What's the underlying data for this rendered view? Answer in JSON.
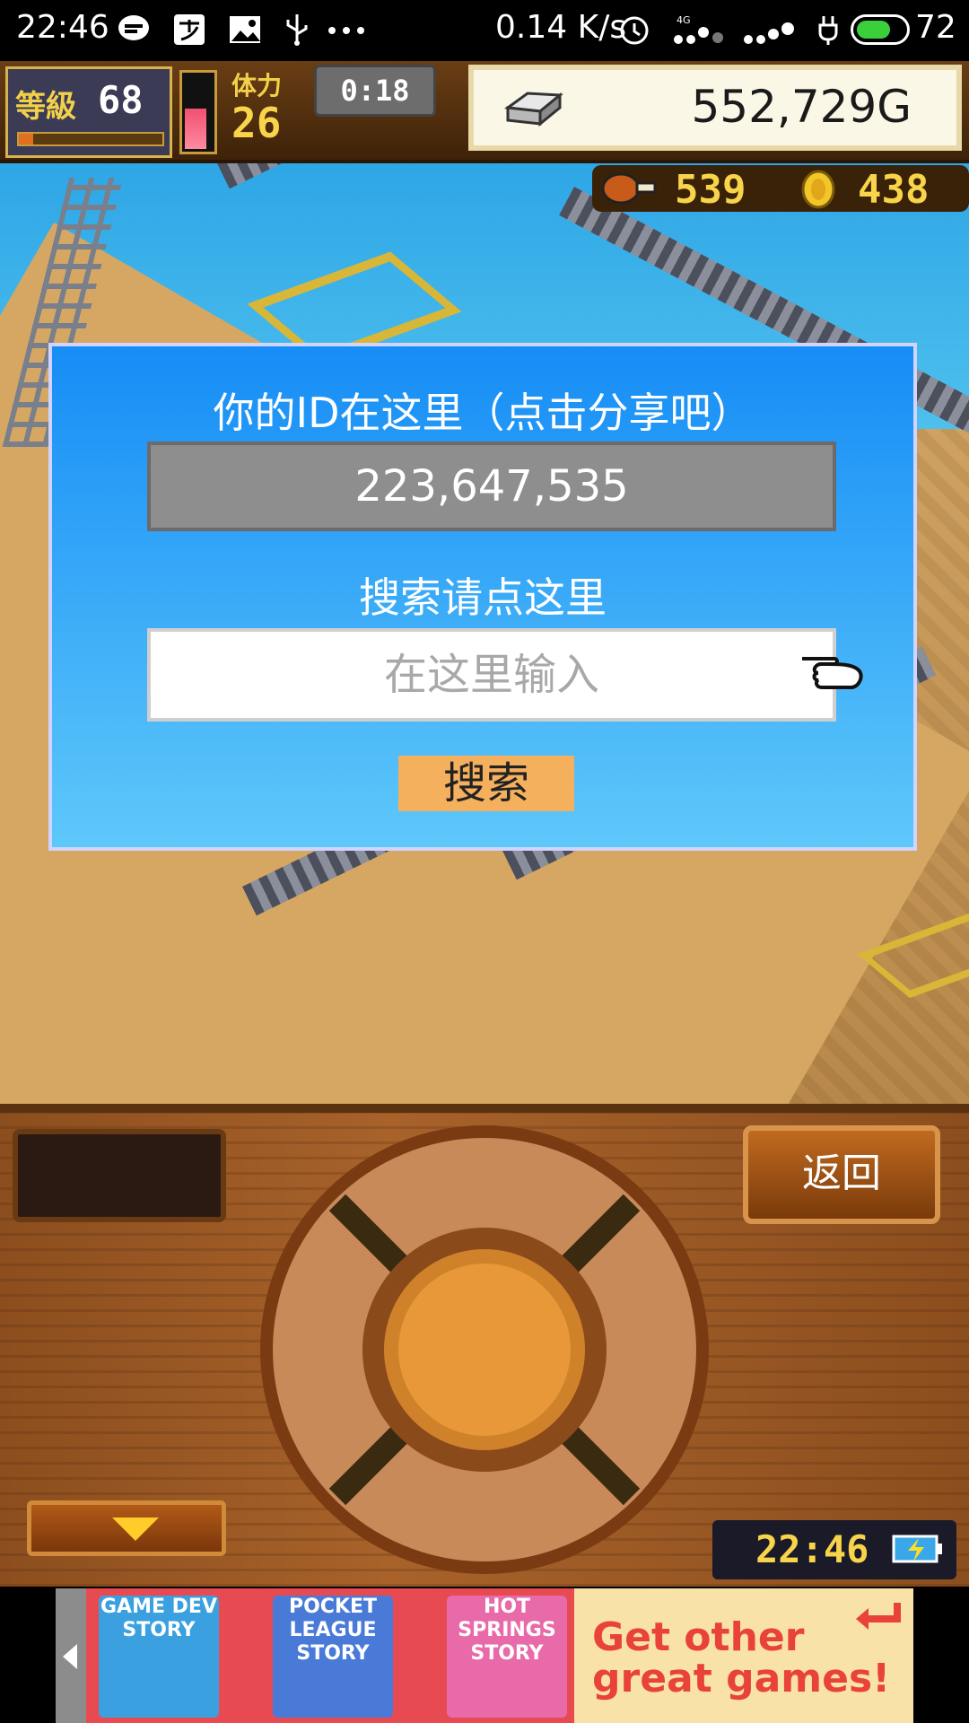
{
  "status_bar": {
    "time": "22:46",
    "net_speed": "0.14 K/s",
    "battery_percent": "72",
    "battery_level": 0.72,
    "icons": [
      "chat-bubble-icon",
      "alipay-icon",
      "image-icon",
      "usb-icon",
      "more-dots-icon",
      "alarm-icon",
      "signal-4g-icon",
      "signal-icon",
      "charging-icon",
      "battery-icon"
    ]
  },
  "hud": {
    "level_label": "等級",
    "level_value": "68",
    "level_progress": 0.1,
    "stamina_label": "体力",
    "stamina_value": "26",
    "stamina_fill": 0.55,
    "timer": "0:18",
    "money": "552,729G",
    "food": "539",
    "coins": "438"
  },
  "dialog": {
    "title": "你的ID在这里（点击分享吧）",
    "user_id": "223,647,535",
    "search_label": "搜索请点这里",
    "search_placeholder": "在这里输入",
    "search_button": "搜索"
  },
  "panel": {
    "back_button": "返回",
    "clock": "22:46"
  },
  "ad": {
    "games": [
      {
        "lines": [
          "GAME DEV",
          "STORY"
        ],
        "color": "#3aa0e0"
      },
      {
        "lines": [
          "POCKET",
          "LEAGUE",
          "STORY"
        ],
        "color": "#4a7ad8"
      },
      {
        "lines": [
          "HOT",
          "SPRINGS",
          "STORY"
        ],
        "color": "#e86aa8"
      }
    ],
    "promo_line1": "Get other",
    "promo_line2": "great games!"
  },
  "colors": {
    "dialog_top": "#168df6",
    "dialog_bottom": "#5ec8fa",
    "search_button": "#f5b05e",
    "money_box": "#fbf7e6",
    "gold_text": "#f7d44a"
  }
}
